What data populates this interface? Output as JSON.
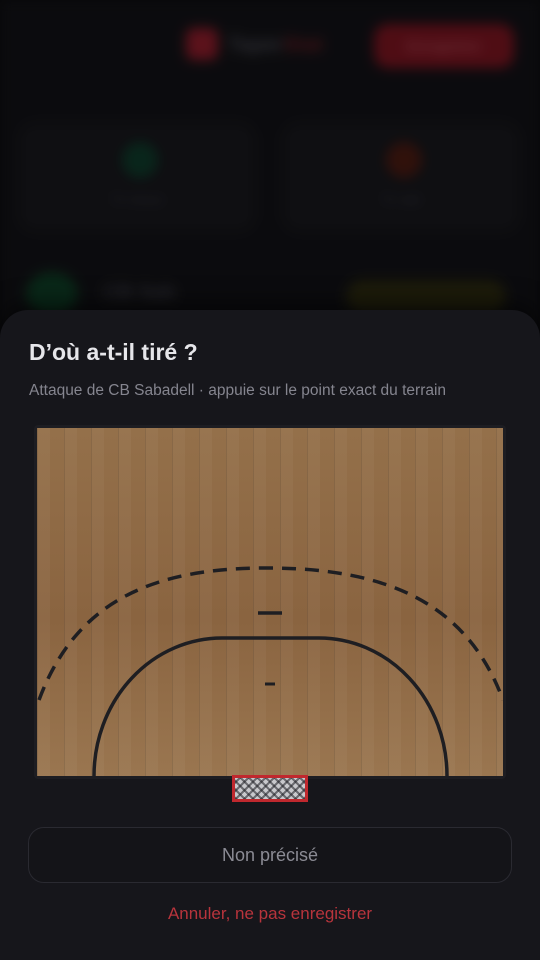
{
  "background": {
    "logo_text_main": "Taper",
    "logo_text_accent": "Stat",
    "cta_label": "Enregistrer",
    "card_left_label": "Tir réussi",
    "card_right_label": "Tir raté",
    "team_name": "CB Sab"
  },
  "sheet": {
    "title": "D’où a-t-il tiré ?",
    "subtitle": "Attaque de CB Sabadell · appuie sur le point exact du terrain",
    "unspecified_label": "Non précisé",
    "cancel_label": "Annuler, ne pas enregistrer"
  },
  "colors": {
    "court_wood": "#8f6a44",
    "court_lines": "#1e1e22",
    "goal_frame": "#c0282e",
    "cancel_text": "#b8343c"
  },
  "icons": {
    "goal": "handball-goal-net"
  }
}
